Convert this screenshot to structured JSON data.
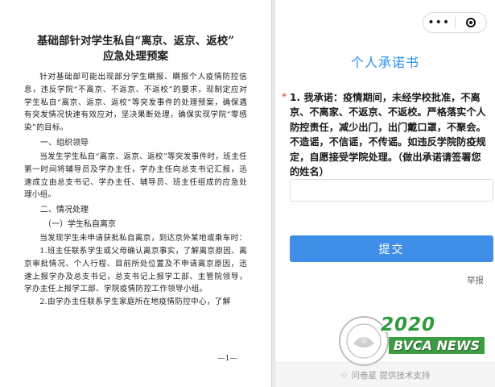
{
  "document": {
    "title_line1": "基础部针对学生私自“离京、返京、返校”",
    "title_line2": "应急处理预案",
    "intro": "针对基础部可能出现部分学生瞒报、瞒报个人疫情防控信息，违反学院“不离京、不返京、不返校”的要求，现制定应对学生私自“离京、返京、返校”等突发事件的处理预案，确保遇有突发情况快速有效应对，坚决果断处理，确保实现学院“零感染”的目标。",
    "section1_heading": "一、组织领导",
    "section1_body": "当发生学生私自“离京、返京、返校”等突发事件时，班主任第一时间将辅导员及学办主任，学办主任向总支书记汇报，迅速成立由总支书记、学办主任、辅导员、班主任组成的应急处理小组。",
    "section2_heading": "二、情况处理",
    "section2_sub": "（一）学生私自离京",
    "section2_body": "当发现学生未申请获批私自离京，到达京外某地或乘车时：",
    "item1": "1.班主任联系学生或父母确认离京事实，了解离京原因、离京审批情况、个人行程、目前所处位置及不申请离京原因，迅速上报学办及总支书记，总支书记上报学工部、主管院领导，学办主任上报学工部、学院疫情防控工作领导小组。",
    "item2": "2.由学办主任联系学生家庭所在地疫情防控中心，了解",
    "page_number": "—1—"
  },
  "form": {
    "capsule_more": "•••",
    "title": "个人承诺书",
    "question_required_mark": "*",
    "question_text": "1. 我承诺：疫情期间，未经学校批准，不离京、不离家、不返京、不返校。严格落实个人防控责任，减少出门，出门戴口罩，不聚会。不造谣，不信谣，不传谣。如违反学院防疫规定，自愿接受学院处理。（做出承诺请签署您的姓名）",
    "answer_value": "",
    "answer_placeholder": "",
    "submit_label": "提交",
    "report_label": "举报",
    "footer_text": "问卷星 提供技术支持"
  },
  "watermark": {
    "year": "2020",
    "brand": "BVCA NEWS"
  },
  "colors": {
    "accent_blue": "#3f8ee8",
    "title_blue": "#2b8ff0",
    "required_red": "#e3352b",
    "watermark_green": "#2e9a3a"
  }
}
